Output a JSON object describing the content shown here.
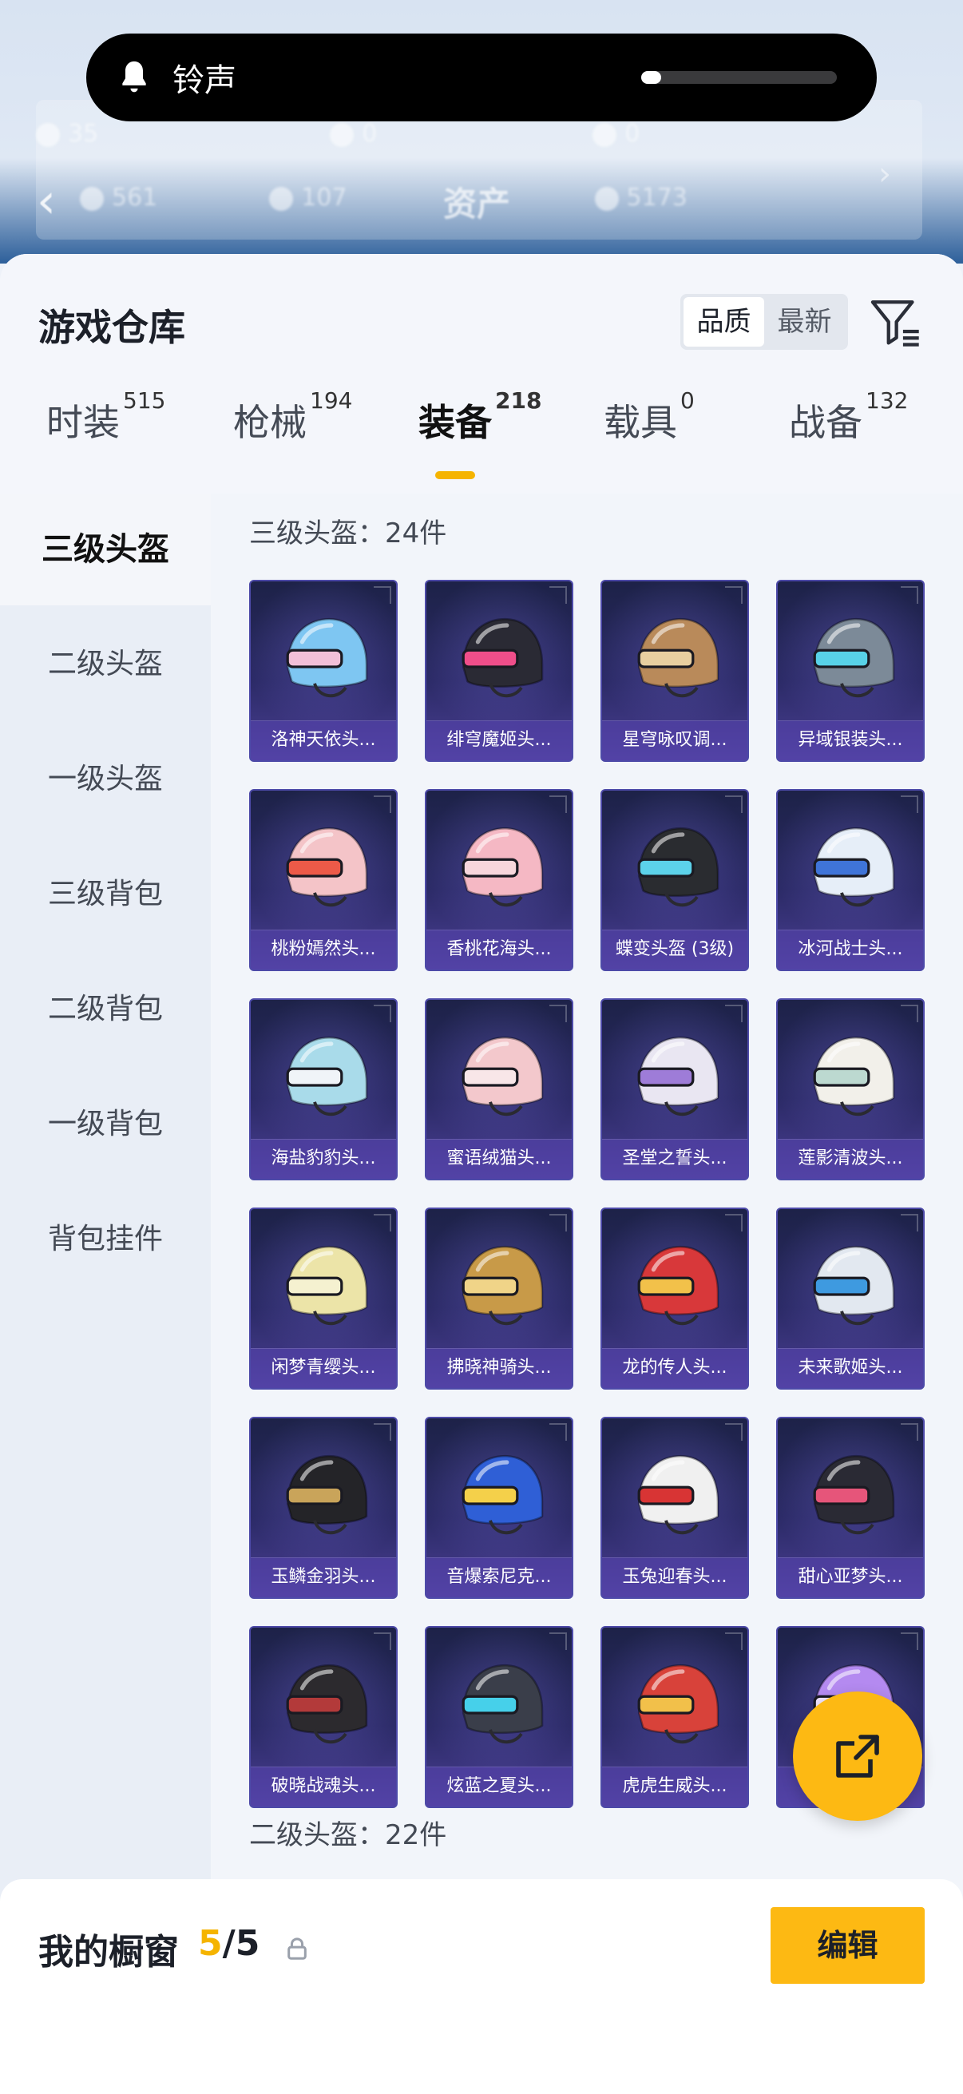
{
  "toast": {
    "label": "铃声",
    "volume_level": 0.1
  },
  "background": {
    "row1": [
      "35",
      "0",
      "0"
    ],
    "row2": [
      "561",
      "107",
      "5173"
    ],
    "assets_label": "资产"
  },
  "header": {
    "title": "游戏仓库"
  },
  "sort": {
    "options": [
      "品质",
      "最新"
    ],
    "selected": "品质"
  },
  "tabs": [
    {
      "label": "时装",
      "count": "515"
    },
    {
      "label": "枪械",
      "count": "194"
    },
    {
      "label": "装备",
      "count": "218",
      "active": true
    },
    {
      "label": "载具",
      "count": "0"
    },
    {
      "label": "战备",
      "count": "132"
    }
  ],
  "sidebar": {
    "items": [
      {
        "label": "三级头盔",
        "active": true
      },
      {
        "label": "二级头盔"
      },
      {
        "label": "一级头盔"
      },
      {
        "label": "三级背包"
      },
      {
        "label": "二级背包"
      },
      {
        "label": "一级背包"
      },
      {
        "label": "背包挂件"
      }
    ]
  },
  "sections": [
    {
      "title": "三级头盔：24件"
    },
    {
      "title": "二级头盔：22件"
    }
  ],
  "items": [
    {
      "name": "洛神天依头...",
      "color": "#7ec6f2",
      "accent": "#f2c0d8"
    },
    {
      "name": "绯穹魔姬头...",
      "color": "#2a2a34",
      "accent": "#f04e8a"
    },
    {
      "name": "星穹咏叹调...",
      "color": "#b98a5a",
      "accent": "#e8cfa0"
    },
    {
      "name": "异域银装头...",
      "color": "#7c8a98",
      "accent": "#58d2e8"
    },
    {
      "name": "桃粉嫣然头...",
      "color": "#f4c4c8",
      "accent": "#ec5a48"
    },
    {
      "name": "香桃花海头...",
      "color": "#f5b8c4",
      "accent": "#f7d6dc"
    },
    {
      "name": "蝶变头盔 (3级)",
      "color": "#2a2c30",
      "accent": "#5cd2ea"
    },
    {
      "name": "冰河战士头...",
      "color": "#e6eef8",
      "accent": "#3f74d8"
    },
    {
      "name": "海盐豹豹头...",
      "color": "#a9dbea",
      "accent": "#f0f4f8"
    },
    {
      "name": "蜜语绒猫头...",
      "color": "#f3c8cc",
      "accent": "#f8e6e8"
    },
    {
      "name": "圣堂之誓头...",
      "color": "#e9e6f2",
      "accent": "#9e7cd8"
    },
    {
      "name": "莲影清波头...",
      "color": "#f2f0ea",
      "accent": "#bcd9d0"
    },
    {
      "name": "闲梦青缨头...",
      "color": "#ece4a8",
      "accent": "#f5f1d0"
    },
    {
      "name": "拂晓神骑头...",
      "color": "#c89a48",
      "accent": "#f0d488"
    },
    {
      "name": "龙的传人头...",
      "color": "#d8383a",
      "accent": "#f2c14a"
    },
    {
      "name": "未来歌姬头...",
      "color": "#e2e8f0",
      "accent": "#3e9ae0"
    },
    {
      "name": "玉鳞金羽头...",
      "color": "#242428",
      "accent": "#c9a45a"
    },
    {
      "name": "音爆索尼克...",
      "color": "#2f5fd6",
      "accent": "#f4d04a"
    },
    {
      "name": "玉兔迎春头...",
      "color": "#f0f0f0",
      "accent": "#d83434"
    },
    {
      "name": "甜心亚梦头...",
      "color": "#2a2a34",
      "accent": "#e6557a"
    },
    {
      "name": "破晓战魂头...",
      "color": "#2c2a2e",
      "accent": "#b33a3a"
    },
    {
      "name": "炫蓝之夏头...",
      "color": "#3a3e4a",
      "accent": "#46d0ea"
    },
    {
      "name": "虎虎生威头...",
      "color": "#d8423a",
      "accent": "#f2c04a"
    },
    {
      "name": "",
      "color": "#b48af0",
      "accent": "#f0e4ff"
    }
  ],
  "showcase": {
    "label": "我的橱窗",
    "current": "5",
    "separator": "/",
    "total": "5",
    "edit_label": "编辑"
  }
}
